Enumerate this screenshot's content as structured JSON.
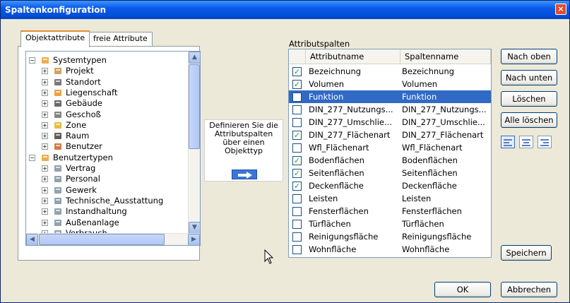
{
  "window": {
    "title": "Spaltenkonfiguration",
    "close_symbol": "×"
  },
  "tabs": [
    {
      "label": "Objektattribute",
      "active": true
    },
    {
      "label": "freie Attribute",
      "active": false
    }
  ],
  "tree": {
    "items": [
      {
        "label": "Systemtypen",
        "level": 0,
        "expander": "−",
        "icon": "system-types-icon"
      },
      {
        "label": "Projekt",
        "level": 1,
        "expander": "+",
        "icon": "project-icon"
      },
      {
        "label": "Standort",
        "level": 1,
        "expander": "+",
        "icon": "location-icon"
      },
      {
        "label": "Liegenschaft",
        "level": 1,
        "expander": "+",
        "icon": "property-icon"
      },
      {
        "label": "Gebäude",
        "level": 1,
        "expander": "+",
        "icon": "building-icon"
      },
      {
        "label": "Geschoß",
        "level": 1,
        "expander": "+",
        "icon": "floor-icon"
      },
      {
        "label": "Zone",
        "level": 1,
        "expander": "+",
        "icon": "zone-icon"
      },
      {
        "label": "Raum",
        "level": 1,
        "expander": "+",
        "icon": "room-icon"
      },
      {
        "label": "Benutzer",
        "level": 1,
        "expander": "+",
        "icon": "user-icon"
      },
      {
        "label": "Benutzertypen",
        "level": 0,
        "expander": "−",
        "icon": "user-types-icon"
      },
      {
        "label": "Vertrag",
        "level": 1,
        "expander": "+",
        "icon": "type-icon"
      },
      {
        "label": "Personal",
        "level": 1,
        "expander": "+",
        "icon": "type-icon"
      },
      {
        "label": "Gewerk",
        "level": 1,
        "expander": "+",
        "icon": "type-icon"
      },
      {
        "label": "Technische_Ausstattung",
        "level": 1,
        "expander": "+",
        "icon": "type-icon"
      },
      {
        "label": "Instandhaltung",
        "level": 1,
        "expander": "+",
        "icon": "type-icon"
      },
      {
        "label": "Außenanlage",
        "level": 1,
        "expander": "+",
        "icon": "type-icon"
      },
      {
        "label": "Verbrauch",
        "level": 1,
        "expander": "+",
        "icon": "type-icon"
      }
    ]
  },
  "hint": {
    "text": "Definieren Sie die Attributspalten über einen Objekttyp"
  },
  "columns": {
    "label": "Attributspalten",
    "headers": {
      "attribute": "Attributname",
      "column": "Spaltenname"
    },
    "rows": [
      {
        "attribute": "Bezeichnung",
        "column": "Bezeichnung",
        "checked": true,
        "selected": false
      },
      {
        "attribute": "Volumen",
        "column": "Volumen",
        "checked": true,
        "selected": false
      },
      {
        "attribute": "Funktion",
        "column": "Funktion",
        "checked": false,
        "selected": true
      },
      {
        "attribute": "DIN_277_Nutzungs...",
        "column": "DIN_277_Nutzungs...",
        "checked": false,
        "selected": false
      },
      {
        "attribute": "DIN_277_Umschlie...",
        "column": "DIN_277_Umschlie...",
        "checked": false,
        "selected": false
      },
      {
        "attribute": "DIN_277_Flächenart",
        "column": "DIN_277_Flächenart",
        "checked": true,
        "selected": false
      },
      {
        "attribute": "Wfl_Flächenart",
        "column": "Wfl_Flächenart",
        "checked": false,
        "selected": false
      },
      {
        "attribute": "Bodenflächen",
        "column": "Bodenflächen",
        "checked": true,
        "selected": false
      },
      {
        "attribute": "Seitenflächen",
        "column": "Seitenflächen",
        "checked": true,
        "selected": false
      },
      {
        "attribute": "Deckenfläche",
        "column": "Deckenfläche",
        "checked": true,
        "selected": false
      },
      {
        "attribute": "Leisten",
        "column": "Leisten",
        "checked": false,
        "selected": false
      },
      {
        "attribute": "Fensterflächen",
        "column": "Fensterflächen",
        "checked": false,
        "selected": false
      },
      {
        "attribute": "Türflächen",
        "column": "Türflächen",
        "checked": false,
        "selected": false
      },
      {
        "attribute": "Reinigungsfläche",
        "column": "Reinigungsfläche",
        "checked": false,
        "selected": false
      },
      {
        "attribute": "Wohnfläche",
        "column": "Wohnfläche",
        "checked": false,
        "selected": false
      }
    ]
  },
  "buttons": {
    "move_up": "Nach oben",
    "move_down": "Nach unten",
    "delete": "Löschen",
    "delete_all": "Alle löschen",
    "save": "Speichern",
    "ok": "OK",
    "cancel": "Abbrechen"
  },
  "colors": {
    "titlebar": "#0a5ae8",
    "selection": "#316ac5",
    "check": "#21a121"
  }
}
